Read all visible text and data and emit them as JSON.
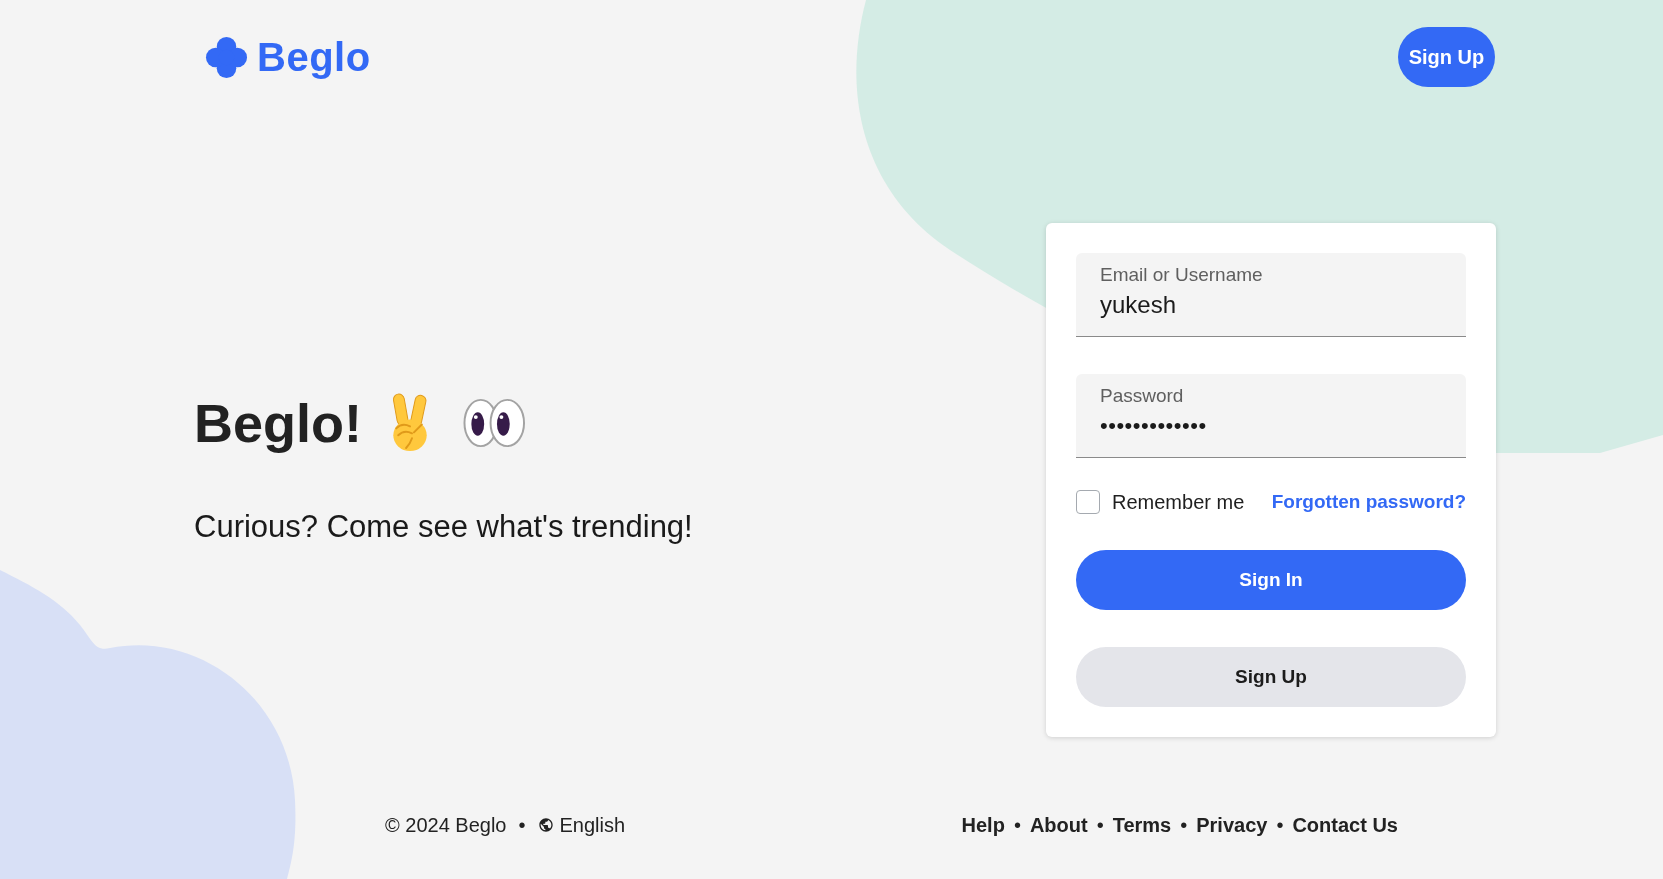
{
  "header": {
    "logo": {
      "text": "Beglo"
    },
    "signup_button": "Sign Up"
  },
  "hero": {
    "title": "Beglo!",
    "subtitle": "Curious? Come see what's trending!"
  },
  "login_form": {
    "fields": [
      {
        "kind": "text",
        "label": "Email or Username",
        "value": "yukesh"
      },
      {
        "kind": "password",
        "label": "Password",
        "value": "•••••••••••••"
      }
    ],
    "remember_me": {
      "label": "Remember me",
      "checked": false
    },
    "forgot_link": "Forgotten password?",
    "buttons": [
      {
        "kind": "primary",
        "label": "Sign In"
      },
      {
        "kind": "secondary",
        "label": "Sign Up"
      }
    ]
  },
  "footer": {
    "copyright": "© 2024 Beglo",
    "separator": "•",
    "language": "English",
    "links": [
      "Help",
      "About",
      "Terms",
      "Privacy",
      "Contact Us"
    ]
  }
}
